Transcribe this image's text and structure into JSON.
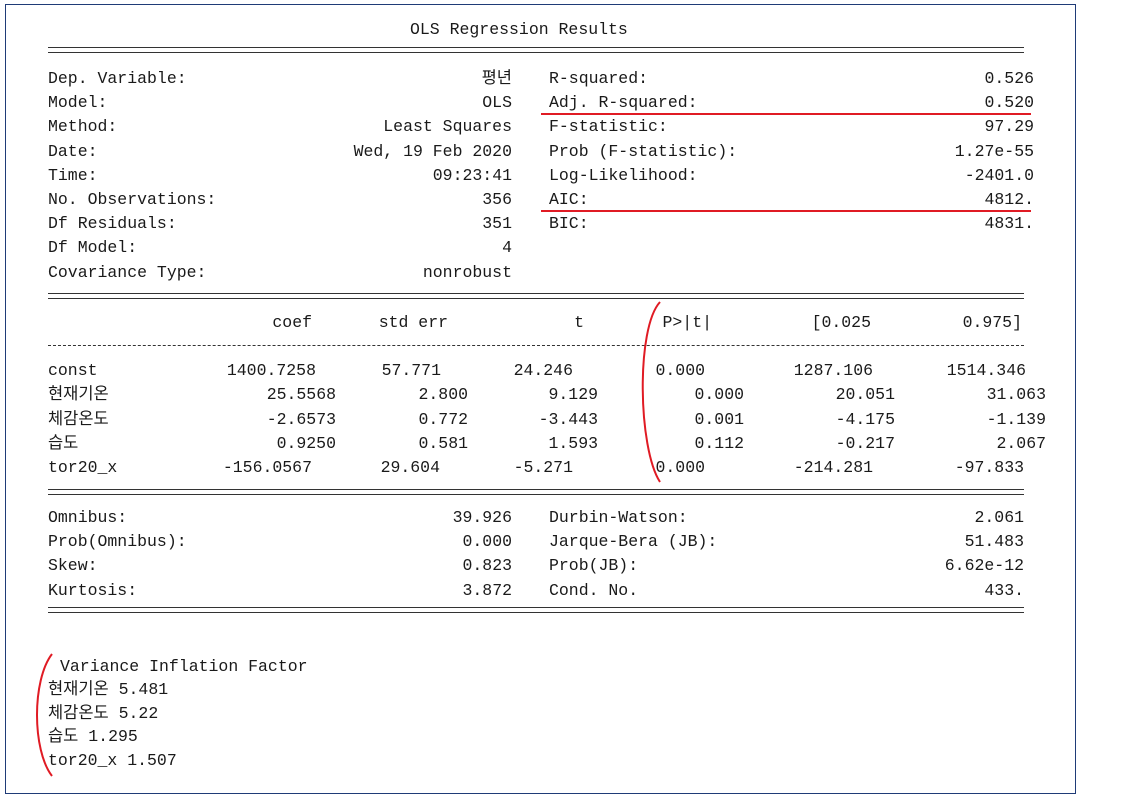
{
  "title": "OLS Regression Results",
  "model_info_left": [
    {
      "label": "Dep. Variable:",
      "value": "평년"
    },
    {
      "label": "Model:",
      "value": "OLS"
    },
    {
      "label": "Method:",
      "value": "Least Squares"
    },
    {
      "label": "Date:",
      "value": "Wed, 19 Feb 2020"
    },
    {
      "label": "Time:",
      "value": "09:23:41"
    },
    {
      "label": "No. Observations:",
      "value": "356"
    },
    {
      "label": "Df Residuals:",
      "value": "351"
    },
    {
      "label": "Df Model:",
      "value": "4"
    },
    {
      "label": "Covariance Type:",
      "value": "nonrobust"
    }
  ],
  "model_info_right": [
    {
      "label": "R-squared:",
      "value": "0.526"
    },
    {
      "label": "Adj. R-squared:",
      "value": "0.520"
    },
    {
      "label": "F-statistic:",
      "value": "97.29"
    },
    {
      "label": "Prob (F-statistic):",
      "value": "1.27e-55"
    },
    {
      "label": "Log-Likelihood:",
      "value": "-2401.0"
    },
    {
      "label": "AIC:",
      "value": "4812."
    },
    {
      "label": "BIC:",
      "value": "4831."
    }
  ],
  "coef_table": {
    "headers": [
      "coef",
      "std err",
      "t",
      "P>|t|",
      "[0.025",
      "0.975]"
    ],
    "rows": [
      {
        "name": "const",
        "coef": "1400.7258",
        "std_err": "57.771",
        "t": "24.246",
        "p": "0.000",
        "lo": "1287.106",
        "hi": "1514.346"
      },
      {
        "name": "현재기온",
        "coef": "25.5568",
        "std_err": "2.800",
        "t": "9.129",
        "p": "0.000",
        "lo": "20.051",
        "hi": "31.063"
      },
      {
        "name": "체감온도",
        "coef": "-2.6573",
        "std_err": "0.772",
        "t": "-3.443",
        "p": "0.001",
        "lo": "-4.175",
        "hi": "-1.139"
      },
      {
        "name": "습도",
        "coef": "0.9250",
        "std_err": "0.581",
        "t": "1.593",
        "p": "0.112",
        "lo": "-0.217",
        "hi": "2.067"
      },
      {
        "name": "tor20_x",
        "coef": "-156.0567",
        "std_err": "29.604",
        "t": "-5.271",
        "p": "0.000",
        "lo": "-214.281",
        "hi": "-97.833"
      }
    ]
  },
  "diagnostics_left": [
    {
      "label": "Omnibus:",
      "value": "39.926"
    },
    {
      "label": "Prob(Omnibus):",
      "value": "0.000"
    },
    {
      "label": "Skew:",
      "value": "0.823"
    },
    {
      "label": "Kurtosis:",
      "value": "3.872"
    }
  ],
  "diagnostics_right": [
    {
      "label": "Durbin-Watson:",
      "value": "2.061"
    },
    {
      "label": "Jarque-Bera (JB):",
      "value": "51.483"
    },
    {
      "label": "Prob(JB):",
      "value": "6.62e-12"
    },
    {
      "label": "Cond. No.",
      "value": "433."
    }
  ],
  "vif": {
    "title": "Variance Inflation Factor",
    "lines": [
      "현재기온 5.481",
      "체감온도 5.22",
      "습도 1.295",
      "tor20_x 1.507"
    ]
  },
  "annotation_color": "#e01b24",
  "frame_color": "#1f3b77"
}
